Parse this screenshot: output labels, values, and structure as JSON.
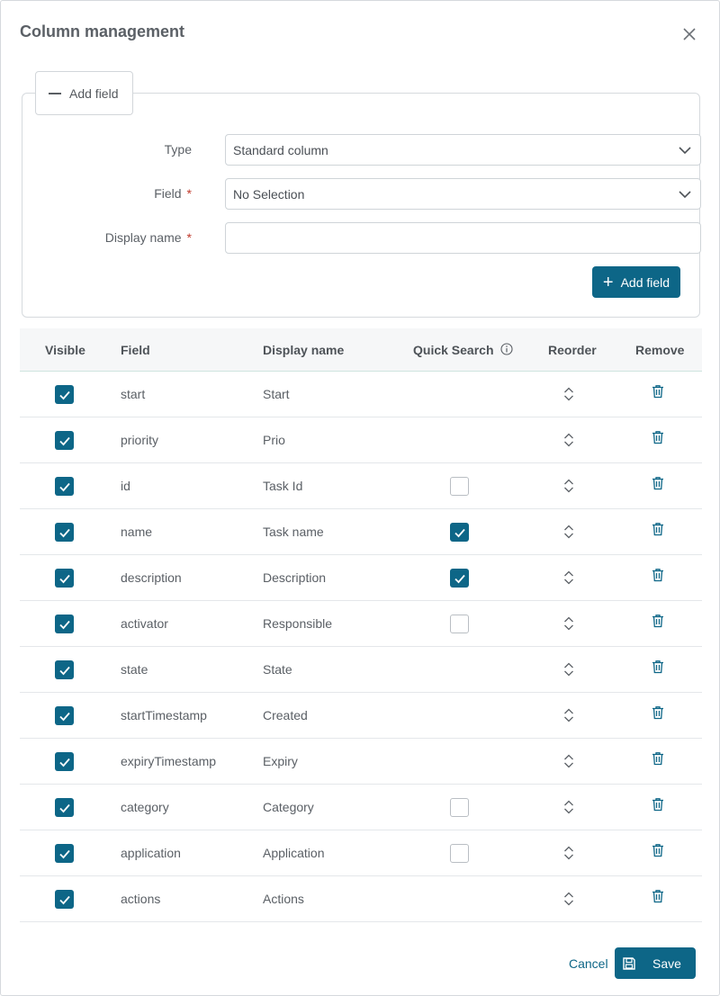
{
  "dialog": {
    "title": "Column management"
  },
  "add_section": {
    "toggle_label": "Add field",
    "type_label": "Type",
    "type_value": "Standard column",
    "field_label": "Field",
    "field_value": "No Selection",
    "display_name_label": "Display name",
    "display_name_value": "",
    "required_marker": "*",
    "add_button_label": "Add field"
  },
  "table": {
    "headers": {
      "visible": "Visible",
      "field": "Field",
      "display_name": "Display name",
      "quick_search": "Quick Search",
      "reorder": "Reorder",
      "remove": "Remove"
    },
    "rows": [
      {
        "visible": true,
        "field": "start",
        "display_name": "Start",
        "quick_search": null
      },
      {
        "visible": true,
        "field": "priority",
        "display_name": "Prio",
        "quick_search": null
      },
      {
        "visible": true,
        "field": "id",
        "display_name": "Task Id",
        "quick_search": false
      },
      {
        "visible": true,
        "field": "name",
        "display_name": "Task name",
        "quick_search": true
      },
      {
        "visible": true,
        "field": "description",
        "display_name": "Description",
        "quick_search": true
      },
      {
        "visible": true,
        "field": "activator",
        "display_name": "Responsible",
        "quick_search": false
      },
      {
        "visible": true,
        "field": "state",
        "display_name": "State",
        "quick_search": null
      },
      {
        "visible": true,
        "field": "startTimestamp",
        "display_name": "Created",
        "quick_search": null
      },
      {
        "visible": true,
        "field": "expiryTimestamp",
        "display_name": "Expiry",
        "quick_search": null
      },
      {
        "visible": true,
        "field": "category",
        "display_name": "Category",
        "quick_search": false
      },
      {
        "visible": true,
        "field": "application",
        "display_name": "Application",
        "quick_search": false
      },
      {
        "visible": true,
        "field": "actions",
        "display_name": "Actions",
        "quick_search": null
      }
    ]
  },
  "footer": {
    "cancel_label": "Cancel",
    "save_label": "Save"
  },
  "colors": {
    "accent": "#0d6687",
    "required": "#c0392b"
  },
  "icons": {
    "close": "close-icon",
    "collapse": "minus-icon",
    "dropdown": "chevron-down-icon",
    "add": "plus-icon",
    "info": "info-icon",
    "reorder": "reorder-icon",
    "remove": "trash-icon",
    "save": "save-icon",
    "check": "checkmark-icon"
  }
}
